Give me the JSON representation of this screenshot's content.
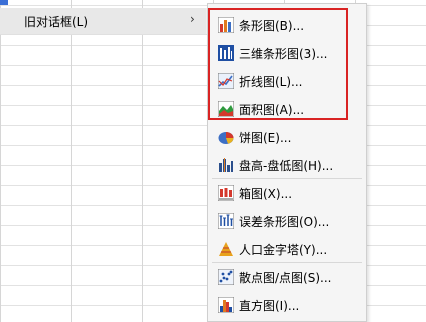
{
  "parent_menu": {
    "item_label": "旧对话框(L)",
    "arrow": "›"
  },
  "submenu": {
    "items": [
      {
        "label": "条形图(B)...",
        "icon": "bar-chart-icon"
      },
      {
        "label": "三维条形图(3)...",
        "icon": "3d-bar-chart-icon"
      },
      {
        "label": "折线图(L)...",
        "icon": "line-chart-icon"
      },
      {
        "label": "面积图(A)...",
        "icon": "area-chart-icon"
      },
      {
        "label": "饼图(E)...",
        "icon": "pie-chart-icon"
      },
      {
        "label": "盘高-盘低图(H)...",
        "icon": "high-low-chart-icon"
      },
      {
        "label": "箱图(X)...",
        "icon": "boxplot-icon"
      },
      {
        "label": "误差条形图(O)...",
        "icon": "error-bar-chart-icon"
      },
      {
        "label": "人口金字塔(Y)...",
        "icon": "population-pyramid-icon"
      },
      {
        "label": "散点图/点图(S)...",
        "icon": "scatter-plot-icon"
      },
      {
        "label": "直方图(I)...",
        "icon": "histogram-icon"
      }
    ]
  },
  "colors": {
    "highlight_border": "#d92323",
    "menu_bg": "#f5f5f5",
    "hover_bg": "#e8e8e8"
  }
}
